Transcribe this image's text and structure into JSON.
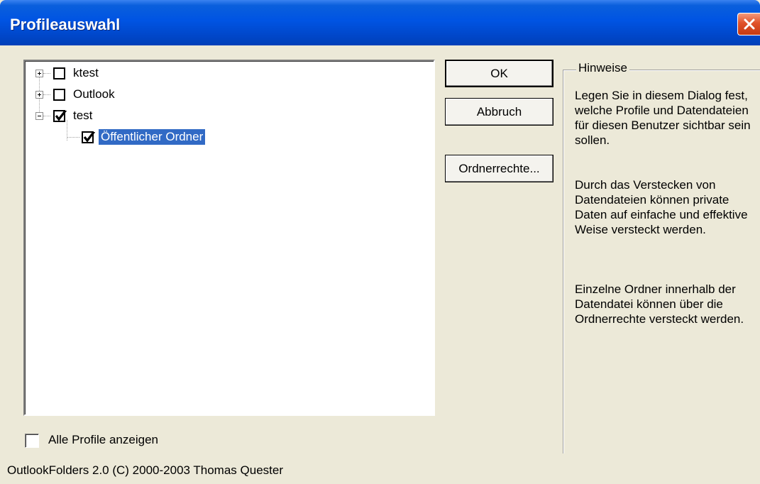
{
  "window": {
    "title": "Profileauswahl"
  },
  "tree": {
    "items": [
      {
        "label": "ktest",
        "checked": false,
        "expander": "plus",
        "selected": false
      },
      {
        "label": "Outlook",
        "checked": false,
        "expander": "plus",
        "selected": false
      },
      {
        "label": "test",
        "checked": true,
        "expander": "minus",
        "selected": false
      },
      {
        "label": "Öffentlicher Ordner",
        "checked": true,
        "expander": "none",
        "selected": true
      }
    ]
  },
  "buttons": {
    "ok": "OK",
    "cancel": "Abbruch",
    "folder_rights": "Ordnerrechte..."
  },
  "hints": {
    "title": "Hinweise",
    "paragraph1": "Legen Sie in diesem Dialog fest, welche Profile und Datendateien für diesen Benutzer sichtbar sein sollen.",
    "paragraph2": "Durch das Verstecken von Datendateien können private Daten auf einfache und effektive Weise versteckt werden.",
    "paragraph3": "Einzelne Ordner innerhalb der Datendatei können über die Ordnerrechte versteckt werden."
  },
  "show_all_profiles": {
    "label": "Alle Profile anzeigen",
    "checked": false
  },
  "footer": {
    "text": "OutlookFolders 2.0 (C) 2000-2003 Thomas Quester"
  },
  "colors": {
    "titlebar": "#0054e3",
    "selection": "#316ac5",
    "dialog_bg": "#ece9d8",
    "close": "#e0512a"
  }
}
